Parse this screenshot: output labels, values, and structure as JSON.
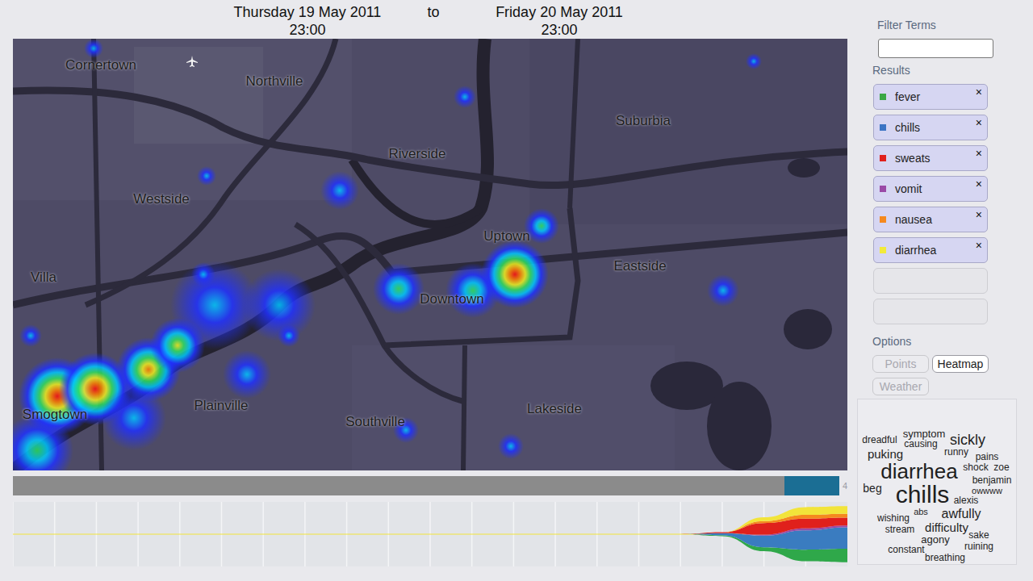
{
  "header": {
    "start_date": "Thursday 19 May 2011",
    "start_time": "23:00",
    "separator": "to",
    "end_date": "Friday 20 May 2011",
    "end_time": "23:00"
  },
  "map": {
    "places": [
      "Cornertown",
      "Northville",
      "Suburbia",
      "Riverside",
      "Westside",
      "Uptown",
      "Eastside",
      "Villa",
      "Downtown",
      "Plainville",
      "Southville",
      "Lakeside",
      "Smogtown"
    ],
    "hotspots": [
      {
        "level": 0.95
      },
      {
        "level": 0.95
      },
      {
        "level": 0.75
      },
      {
        "level": 0.6
      },
      {
        "level": 0.3
      },
      {
        "level": 0.3
      },
      {
        "level": 0.25
      },
      {
        "level": 0.45
      },
      {
        "level": 0.45
      },
      {
        "level": 0.95
      },
      {
        "level": 0.35
      },
      {
        "level": 0.25
      },
      {
        "level": 0.25
      },
      {
        "level": 0.25
      },
      {
        "level": 0.25
      },
      {
        "level": 0.25
      },
      {
        "level": 0.25
      },
      {
        "level": 0.25
      },
      {
        "level": 0.25
      },
      {
        "level": 0.25
      },
      {
        "level": 0.2
      },
      {
        "level": 0.35
      },
      {
        "level": 0.2
      },
      {
        "level": 0.2
      }
    ]
  },
  "filter": {
    "label": "Filter Terms",
    "value": ""
  },
  "results": {
    "label": "Results",
    "items": [
      {
        "label": "fever",
        "color": "#3aa845",
        "remove": "×"
      },
      {
        "label": "chills",
        "color": "#3b74c4",
        "remove": "×"
      },
      {
        "label": "sweats",
        "color": "#e0201c",
        "remove": "×"
      },
      {
        "label": "vomit",
        "color": "#9a4aa6",
        "remove": "×"
      },
      {
        "label": "nausea",
        "color": "#f5891e",
        "remove": "×"
      },
      {
        "label": "diarrhea",
        "color": "#f2ea3a",
        "remove": "×"
      }
    ],
    "empty_slots": 2
  },
  "options": {
    "label": "Options",
    "buttons": [
      {
        "label": "Points",
        "selected": false,
        "disabled": true
      },
      {
        "label": "Heatmap",
        "selected": true,
        "disabled": false
      },
      {
        "label": "Weather",
        "selected": false,
        "disabled": true
      }
    ]
  },
  "timeline": {
    "start": 0.934,
    "end": 1.0,
    "label": "4"
  },
  "chart": {
    "series": [
      {
        "name": "fever",
        "color": "#2fa84a",
        "values": [
          0,
          0,
          0,
          0,
          0,
          0,
          0,
          0,
          0,
          0,
          0,
          0,
          0,
          0,
          0,
          0,
          0,
          0.5,
          2,
          6,
          7
        ]
      },
      {
        "name": "chills",
        "color": "#3a7cc0",
        "values": [
          0,
          0,
          0,
          0,
          0,
          0,
          0,
          0,
          0,
          0,
          0,
          0,
          0,
          0,
          0,
          0,
          0,
          1,
          6,
          10,
          11
        ]
      },
      {
        "name": "vomit",
        "color": "#9a4aa6",
        "values": [
          0,
          0,
          0,
          0,
          0,
          0,
          0,
          0,
          0,
          0,
          0,
          0,
          0,
          0,
          0,
          0,
          0,
          0,
          0.5,
          1,
          1
        ]
      },
      {
        "name": "sweats",
        "color": "#e0201c",
        "values": [
          0,
          0,
          0,
          0,
          0,
          0,
          0,
          0,
          0,
          0,
          0,
          0,
          0,
          0,
          0,
          0,
          0,
          0.5,
          6,
          5,
          4
        ]
      },
      {
        "name": "nausea",
        "color": "#f5891e",
        "values": [
          0,
          0,
          0,
          0,
          0,
          0,
          0,
          0,
          0,
          0,
          0,
          0,
          0,
          0,
          0,
          0,
          0,
          0,
          1,
          2,
          2
        ]
      },
      {
        "name": "diarrhea",
        "color": "#f2e43a",
        "values": [
          0,
          0,
          0,
          0,
          0,
          0,
          0,
          0,
          0,
          0,
          0,
          0,
          0,
          0,
          0,
          0,
          0,
          0,
          2,
          4,
          4
        ]
      }
    ]
  },
  "word_cloud": {
    "words": [
      {
        "text": "symptom",
        "weight": 0.14
      },
      {
        "text": "dreadful",
        "weight": 0.09
      },
      {
        "text": "causing",
        "weight": 0.09
      },
      {
        "text": "sickly",
        "weight": 0.36
      },
      {
        "text": "puking",
        "weight": 0.23
      },
      {
        "text": "runny",
        "weight": 0.09
      },
      {
        "text": "pains",
        "weight": 0.09
      },
      {
        "text": "diarrhea",
        "weight": 0.73
      },
      {
        "text": "shock",
        "weight": 0.09
      },
      {
        "text": "zoe",
        "weight": 0.09
      },
      {
        "text": "beg",
        "weight": 0.18
      },
      {
        "text": "benjamin",
        "weight": 0.09
      },
      {
        "text": "owwww",
        "weight": 0.05
      },
      {
        "text": "chills",
        "weight": 0.91
      },
      {
        "text": "alexis",
        "weight": 0.09
      },
      {
        "text": "abs",
        "weight": 0.05
      },
      {
        "text": "awfully",
        "weight": 0.27
      },
      {
        "text": "wishing",
        "weight": 0.09
      },
      {
        "text": "difficulty",
        "weight": 0.23
      },
      {
        "text": "stream",
        "weight": 0.09
      },
      {
        "text": "agony",
        "weight": 0.14
      },
      {
        "text": "sake",
        "weight": 0.09
      },
      {
        "text": "ruining",
        "weight": 0.09
      },
      {
        "text": "constant",
        "weight": 0.09
      },
      {
        "text": "breathing",
        "weight": 0.09
      }
    ]
  }
}
